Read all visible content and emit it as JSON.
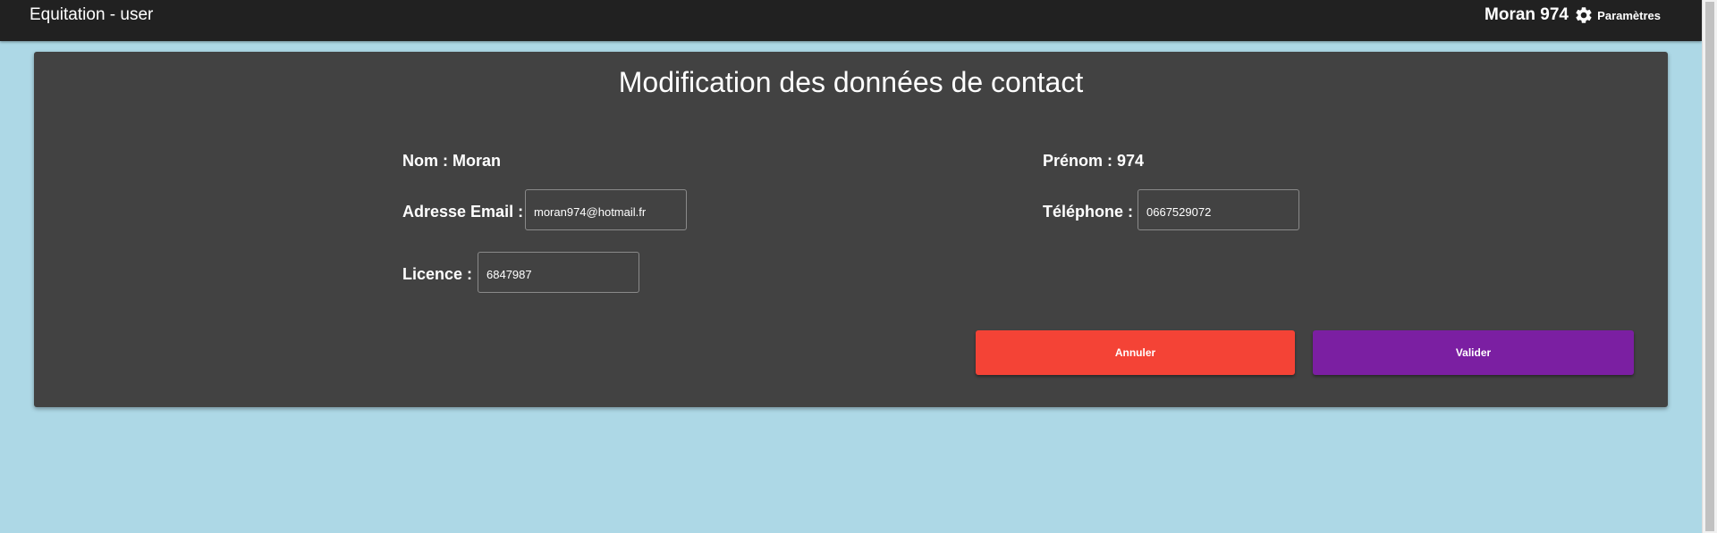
{
  "header": {
    "app_title": "Equitation - user",
    "user_name": "Moran 974",
    "settings_label": "Paramètres",
    "settings_icon": "gear-icon"
  },
  "form": {
    "title": "Modification des données de contact",
    "nom_label": "Nom : Moran",
    "prenom_label": "Prénom : 974",
    "email_label": "Adresse Email :",
    "email_value": "moran974@hotmail.fr",
    "telephone_label": "Téléphone :",
    "telephone_value": "0667529072",
    "licence_label": "Licence :",
    "licence_value": "6847987",
    "cancel_label": "Annuler",
    "validate_label": "Valider"
  },
  "colors": {
    "page_background": "#add8e6",
    "topbar": "#212121",
    "card": "#424242",
    "cancel_button": "#f44336",
    "validate_button": "#7b1fa2"
  }
}
